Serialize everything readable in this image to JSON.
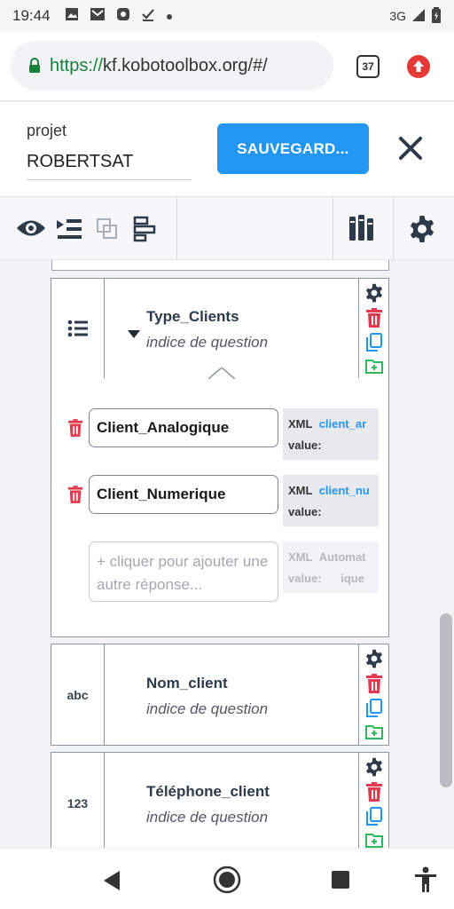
{
  "status_bar": {
    "time": "19:44",
    "network": "3G"
  },
  "browser": {
    "url_scheme": "https://",
    "url_rest": "kf.kobotoolbox.org/#/",
    "tab_count": "37"
  },
  "header": {
    "project_label": "projet",
    "project_name": "ROBERTSAT",
    "save_label": "SAUVEGARD..."
  },
  "questions": [
    {
      "type_label": "",
      "name": "Type_Clients",
      "hint": "indice de question"
    },
    {
      "type_label": "abc",
      "name": "Nom_client",
      "hint": "indice de question"
    },
    {
      "type_label": "123",
      "name": "Téléphone_client",
      "hint": "indice de question"
    }
  ],
  "choices": [
    {
      "label": "Client_Analogique",
      "xml_label": "XML",
      "xml_value": "client_ar",
      "value_label": "value:"
    },
    {
      "label": "Client_Numerique",
      "xml_label": "XML",
      "xml_value": "client_nu",
      "value_label": "value:"
    }
  ],
  "add_choice": {
    "placeholder": "+ cliquer pour ajouter une autre réponse...",
    "xml_label": "XML",
    "xml_value": "Automat",
    "value_label": "value:",
    "value_suffix": "ique"
  },
  "colors": {
    "accent": "#2196f3",
    "danger": "#e53950",
    "success": "#2eb85c",
    "text": "#2d3a4a"
  }
}
